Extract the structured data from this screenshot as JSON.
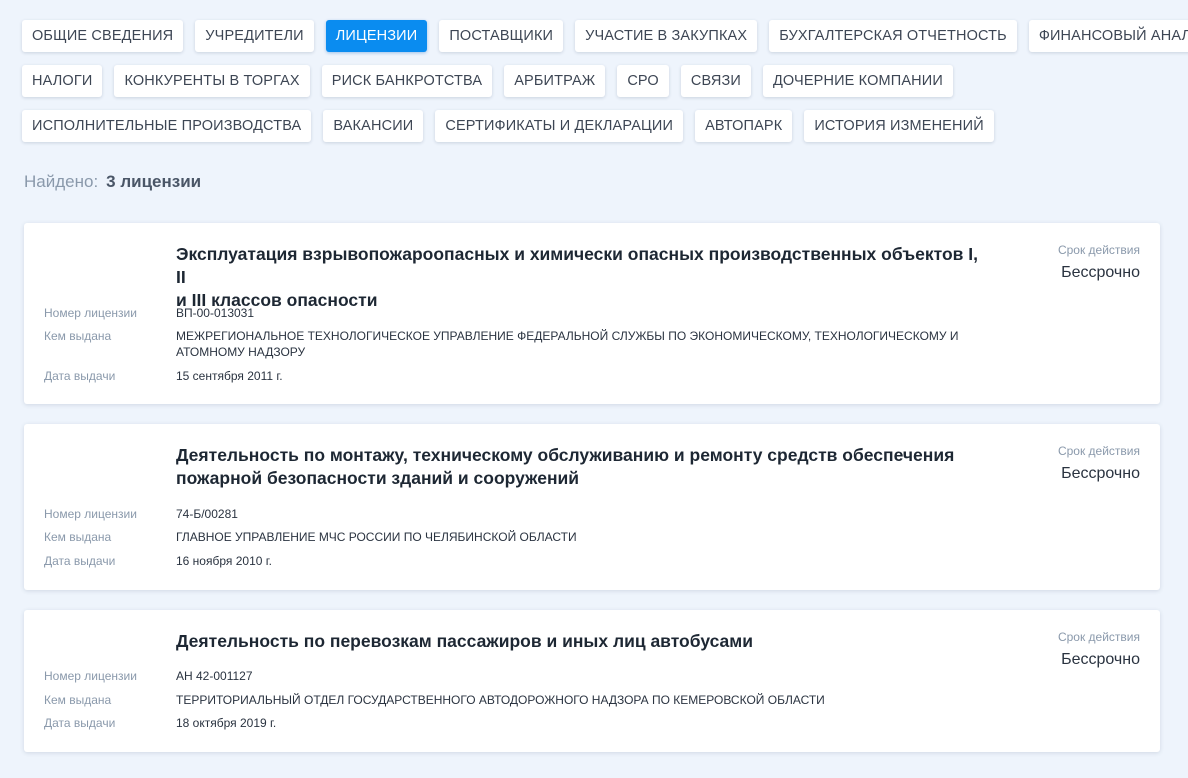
{
  "tabs": {
    "row1": [
      "ОБЩИЕ СВЕДЕНИЯ",
      "УЧРЕДИТЕЛИ",
      "ЛИЦЕНЗИИ",
      "ПОСТАВЩИКИ",
      "УЧАСТИЕ В ЗАКУПКАХ",
      "БУХГАЛТЕРСКАЯ ОТЧЕТНОСТЬ",
      "ФИНАНСОВЫЙ АНАЛИЗ"
    ],
    "row2": [
      "НАЛОГИ",
      "КОНКУРЕНТЫ В ТОРГАХ",
      "РИСК БАНКРОТСТВА",
      "АРБИТРАЖ",
      "СРО",
      "СВЯЗИ",
      "ДОЧЕРНИЕ КОМПАНИИ"
    ],
    "row3": [
      "ИСПОЛНИТЕЛЬНЫЕ ПРОИЗВОДСТВА",
      "ВАКАНСИИ",
      "СЕРТИФИКАТЫ И ДЕКЛАРАЦИИ",
      "АВТОПАРК",
      "ИСТОРИЯ ИЗМЕНЕНИЙ"
    ],
    "active": "ЛИЦЕНЗИИ"
  },
  "colors": {
    "accent": "#0a8cf0",
    "background": "#eef4fc"
  },
  "summary": {
    "label": "Найдено:",
    "count_text": "3 лицензии"
  },
  "field_labels": {
    "number": "Номер лицензии",
    "issuer": "Кем выдана",
    "date": "Дата выдачи",
    "validity": "Срок действия"
  },
  "licenses": [
    {
      "title_line1": "Эксплуатация взрывопожароопасных и химически опасных производственных объектов I, II",
      "title_line2": "и III классов опасности",
      "validity": "Бессрочно",
      "number": "ВП-00-013031",
      "issuer_line1": "МЕЖРЕГИОНАЛЬНОЕ ТЕХНОЛОГИЧЕСКОЕ УПРАВЛЕНИЕ ФЕДЕРАЛЬНОЙ СЛУЖБЫ ПО ЭКОНОМИЧЕСКОМУ, ТЕХНОЛОГИЧЕСКОМУ И",
      "issuer_line2": "АТОМНОМУ НАДЗОРУ",
      "date": "15 сентября 2011 г."
    },
    {
      "title_line1": "Деятельность по монтажу, техническому обслуживанию и ремонту средств обеспечения",
      "title_line2": "пожарной безопасности зданий и сооружений",
      "validity": "Бессрочно",
      "number": "74-Б/00281",
      "issuer_line1": "ГЛАВНОЕ УПРАВЛЕНИЕ МЧС РОССИИ ПО ЧЕЛЯБИНСКОЙ ОБЛАСТИ",
      "date": "16 ноября 2010 г."
    },
    {
      "title_line1": "Деятельность по перевозкам пассажиров и иных лиц автобусами",
      "validity": "Бессрочно",
      "number": "АН 42-001127",
      "issuer_line1": "ТЕРРИТОРИАЛЬНЫЙ ОТДЕЛ ГОСУДАРСТВЕННОГО АВТОДОРОЖНОГО НАДЗОРА ПО КЕМЕРОВСКОЙ ОБЛАСТИ",
      "date": "18 октября 2019 г."
    }
  ]
}
